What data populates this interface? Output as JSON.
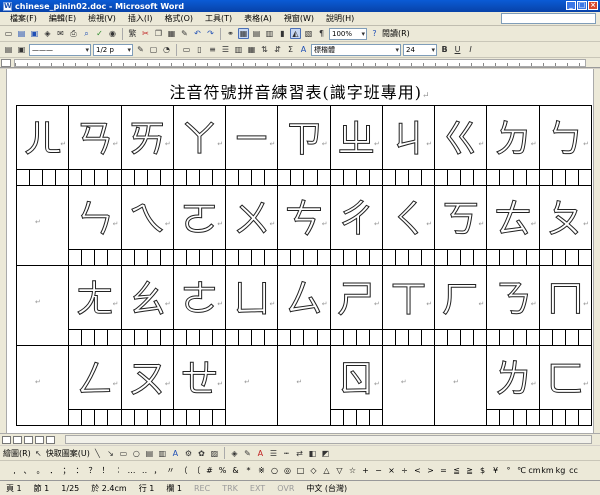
{
  "window": {
    "title": "chinese_pinin02.doc - Microsoft Word"
  },
  "menu": [
    "檔案(F)",
    "編輯(E)",
    "檢視(V)",
    "插入(I)",
    "格式(O)",
    "工具(T)",
    "表格(A)",
    "視窗(W)",
    "說明(H)"
  ],
  "toolbar": {
    "zoom": "100%",
    "read_label": "閱讀(R)",
    "style_value": "1/2 p",
    "font_name": "標楷體",
    "font_size": "24",
    "bold": "B",
    "underline": "U",
    "italic": "I"
  },
  "document": {
    "title": "注音符號拼音練習表(識字班專用)",
    "grid": [
      [
        "ㄦ",
        "ㄢ",
        "ㄞ",
        "ㄚ",
        "ㄧ",
        "ㄗ",
        "ㄓ",
        "ㄐ",
        "ㄍ",
        "ㄉ",
        "ㄅ"
      ],
      [
        "",
        "ㄣ",
        "ㄟ",
        "ㄛ",
        "ㄨ",
        "ㄘ",
        "ㄔ",
        "ㄑ",
        "ㄎ",
        "ㄊ",
        "ㄆ"
      ],
      [
        "",
        "ㄤ",
        "ㄠ",
        "ㄜ",
        "ㄩ",
        "ㄙ",
        "ㄕ",
        "ㄒ",
        "ㄏ",
        "ㄋ",
        "ㄇ"
      ],
      [
        "",
        "ㄥ",
        "ㄡ",
        "ㄝ",
        "",
        "",
        "ㄖ",
        "",
        "",
        "ㄌ",
        "ㄈ"
      ]
    ]
  },
  "drawbar": {
    "draw_label": "繪圖(R)",
    "autoshape_label": "快取圖案(U)"
  },
  "symbols": [
    ",",
    "、",
    "。",
    "．",
    "；",
    "：",
    "？",
    "！",
    "︰",
    "…",
    "‥",
    "，",
    "〃",
    "（",
    "〔",
    "#",
    "%",
    "&",
    "*",
    "※",
    "○",
    "◎",
    "□",
    "◇",
    "△",
    "▽",
    "☆",
    "+",
    "−",
    "×",
    "÷",
    "<",
    ">",
    "=",
    "≦",
    "≧",
    "$",
    "¥",
    "°",
    "℃",
    "cm",
    "km",
    "kg",
    "cc"
  ],
  "status": {
    "page": "頁 1",
    "section": "節 1",
    "pages": "1/25",
    "at": "於 2.4cm",
    "line": "行 1",
    "col": "欄 1",
    "rec": "REC",
    "trk": "TRK",
    "ext": "EXT",
    "ovr": "OVR",
    "lang": "中文 (台灣)"
  }
}
